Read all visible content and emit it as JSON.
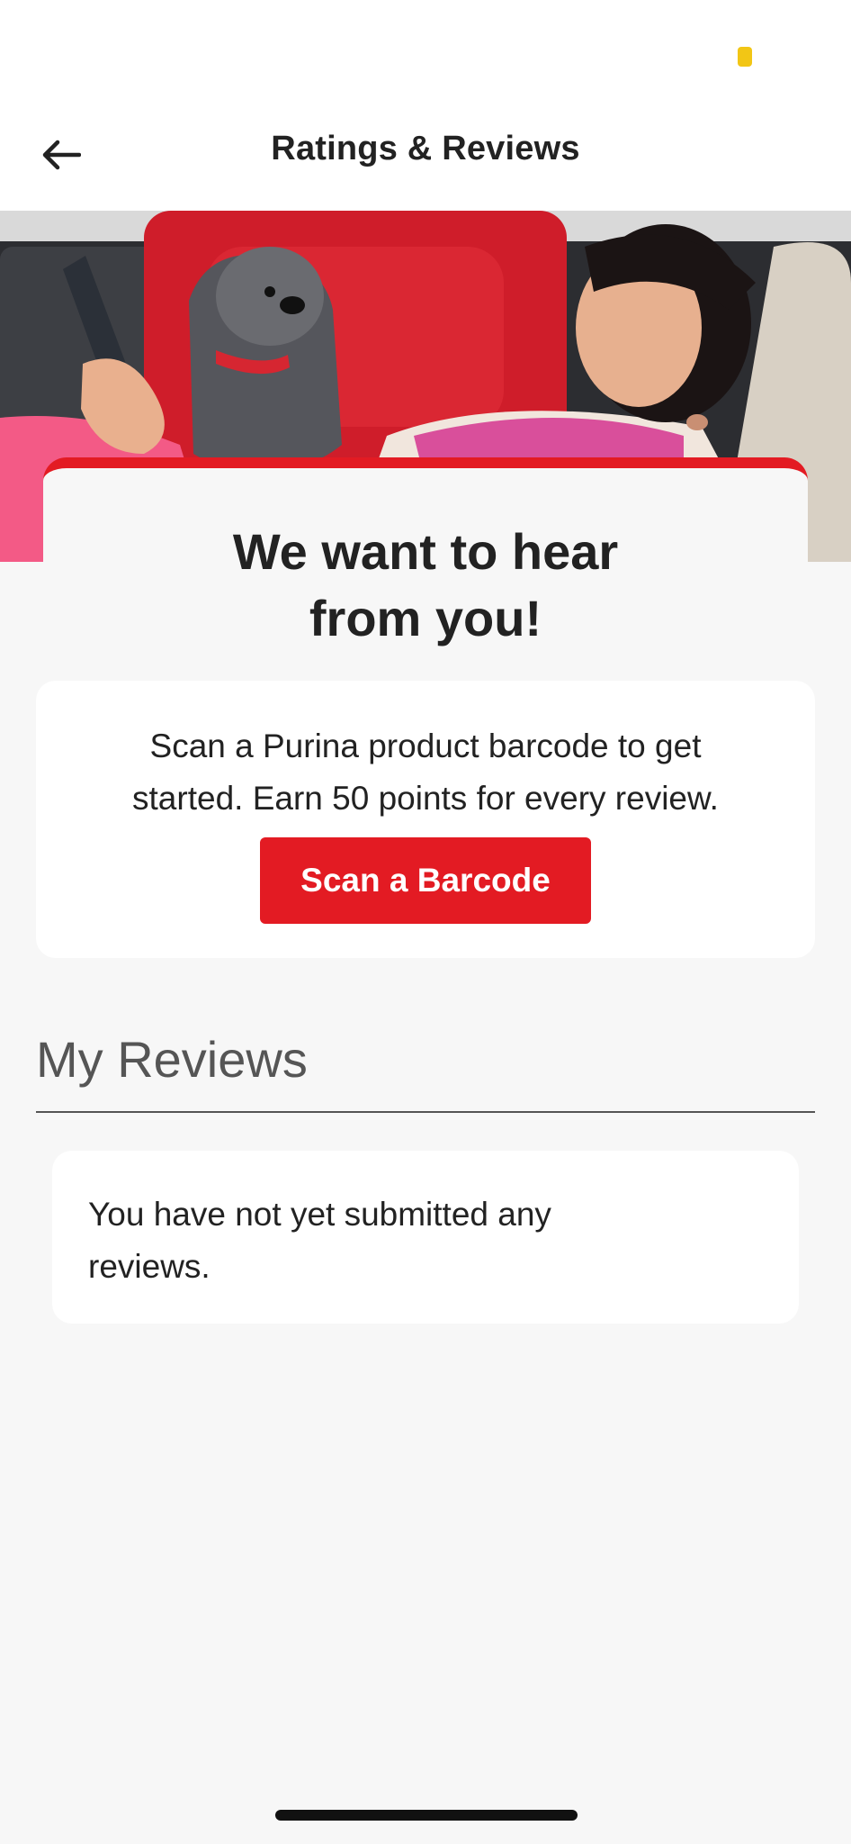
{
  "header": {
    "title": "Ratings & Reviews",
    "back_icon": "arrow-left-icon"
  },
  "hero": {
    "image": "girl-with-dog-photo"
  },
  "intro": {
    "heading_line1": "We want to hear",
    "heading_line2": "from you!"
  },
  "scan": {
    "text_line1": "Scan a Purina product barcode to get",
    "text_line2": "started. Earn 50 points for every review.",
    "button_label": "Scan a Barcode"
  },
  "my_reviews": {
    "title": "My Reviews",
    "empty_line1": "You have not yet submitted any",
    "empty_line2": "reviews."
  },
  "colors": {
    "accent": "#e31b23",
    "background": "#f7f7f7",
    "card": "#ffffff",
    "text": "#222222"
  }
}
